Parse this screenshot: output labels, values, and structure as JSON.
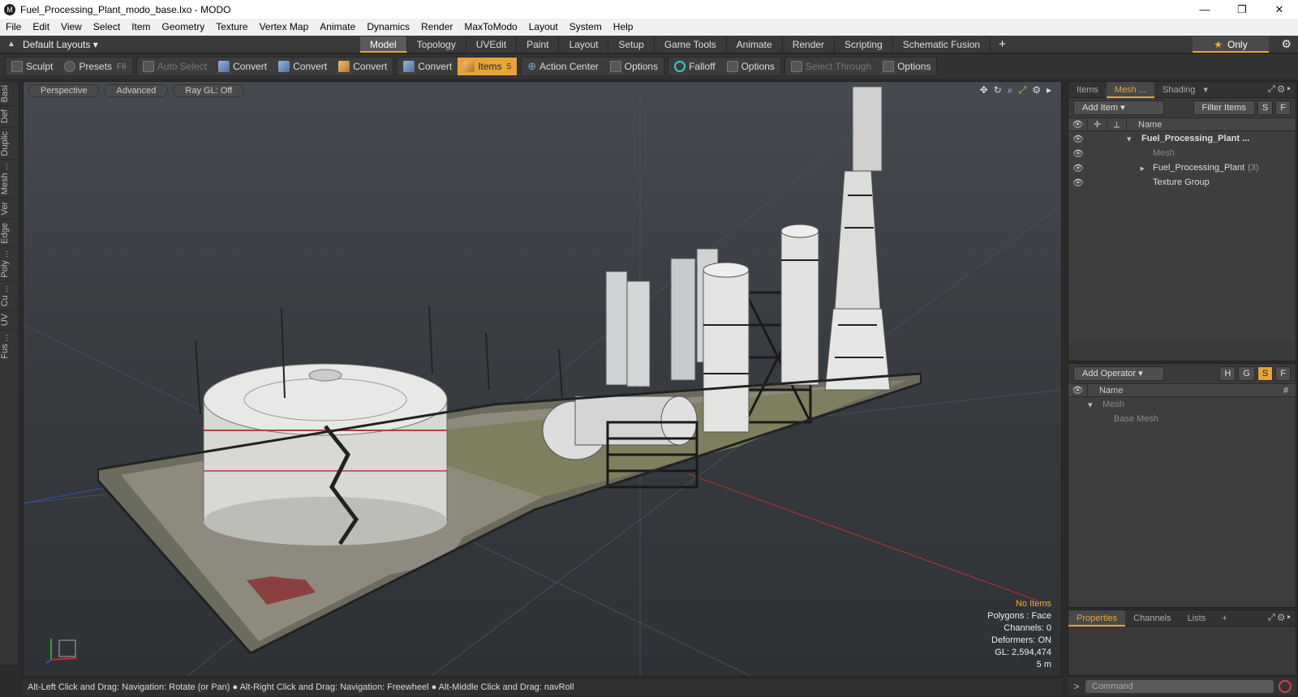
{
  "window": {
    "title": "Fuel_Processing_Plant_modo_base.lxo - MODO",
    "min": "—",
    "max": "❐",
    "close": "✕"
  },
  "menu": [
    "File",
    "Edit",
    "View",
    "Select",
    "Item",
    "Geometry",
    "Texture",
    "Vertex Map",
    "Animate",
    "Dynamics",
    "Render",
    "MaxToModo",
    "Layout",
    "System",
    "Help"
  ],
  "layoutbar": {
    "layouts_label": "Default Layouts ▾",
    "tabs": [
      "Model",
      "Topology",
      "UVEdit",
      "Paint",
      "Layout",
      "Setup",
      "Game Tools",
      "Animate",
      "Render",
      "Scripting",
      "Schematic Fusion"
    ],
    "active_tab": "Model",
    "plus": "+",
    "only_label": "Only"
  },
  "toolbar": {
    "sculpt": "Sculpt",
    "presets": "Presets",
    "presets_key": "F6",
    "auto_select": "Auto Select",
    "convert1": "Convert",
    "convert2": "Convert",
    "convert3": "Convert",
    "convert4": "Convert",
    "items": "Items",
    "items_key": "5",
    "action_center": "Action Center",
    "options1": "Options",
    "falloff": "Falloff",
    "options2": "Options",
    "select_through": "Select Through",
    "options3": "Options"
  },
  "left_tabs": [
    "Basi",
    "Def",
    "Duplic",
    "Mesh ...",
    "Ver",
    "Edge",
    "Poly ...",
    "Cu ...",
    "UV",
    "Fus ..."
  ],
  "viewport": {
    "perspective": "Perspective",
    "advanced": "Advanced",
    "raygl": "Ray GL: Off",
    "info": {
      "no_items": "No Items",
      "polygons": "Polygons : Face",
      "channels": "Channels: 0",
      "deformers": "Deformers: ON",
      "gl": "GL: 2,594,474",
      "scale": "5 m"
    }
  },
  "status": "Alt-Left Click and Drag: Navigation: Rotate (or Pan) ● Alt-Right Click and Drag: Navigation: Freewheel ● Alt-Middle Click and Drag: navRoll",
  "items_panel": {
    "tabs": [
      "Items",
      "Mesh ...",
      "Shading"
    ],
    "active": "Mesh ...",
    "add_item": "Add Item",
    "filter_items": "Filter Items",
    "s": "S",
    "f": "F",
    "name_col": "Name",
    "rows": [
      {
        "name": "Fuel_Processing_Plant ...",
        "count": ""
      },
      {
        "name": "Mesh",
        "count": ""
      },
      {
        "name": "Fuel_Processing_Plant",
        "count": "(3)"
      },
      {
        "name": "Texture Group",
        "count": ""
      }
    ]
  },
  "operator_panel": {
    "add_operator": "Add Operator",
    "h": "H",
    "g": "G",
    "s": "S",
    "f": "F",
    "name_col": "Name",
    "hash_col": "#",
    "rows": [
      "Mesh",
      "Base Mesh"
    ]
  },
  "properties_panel": {
    "tabs": [
      "Properties",
      "Channels",
      "Lists"
    ],
    "active": "Properties",
    "plus": "+"
  },
  "command": {
    "placeholder": "Command"
  }
}
